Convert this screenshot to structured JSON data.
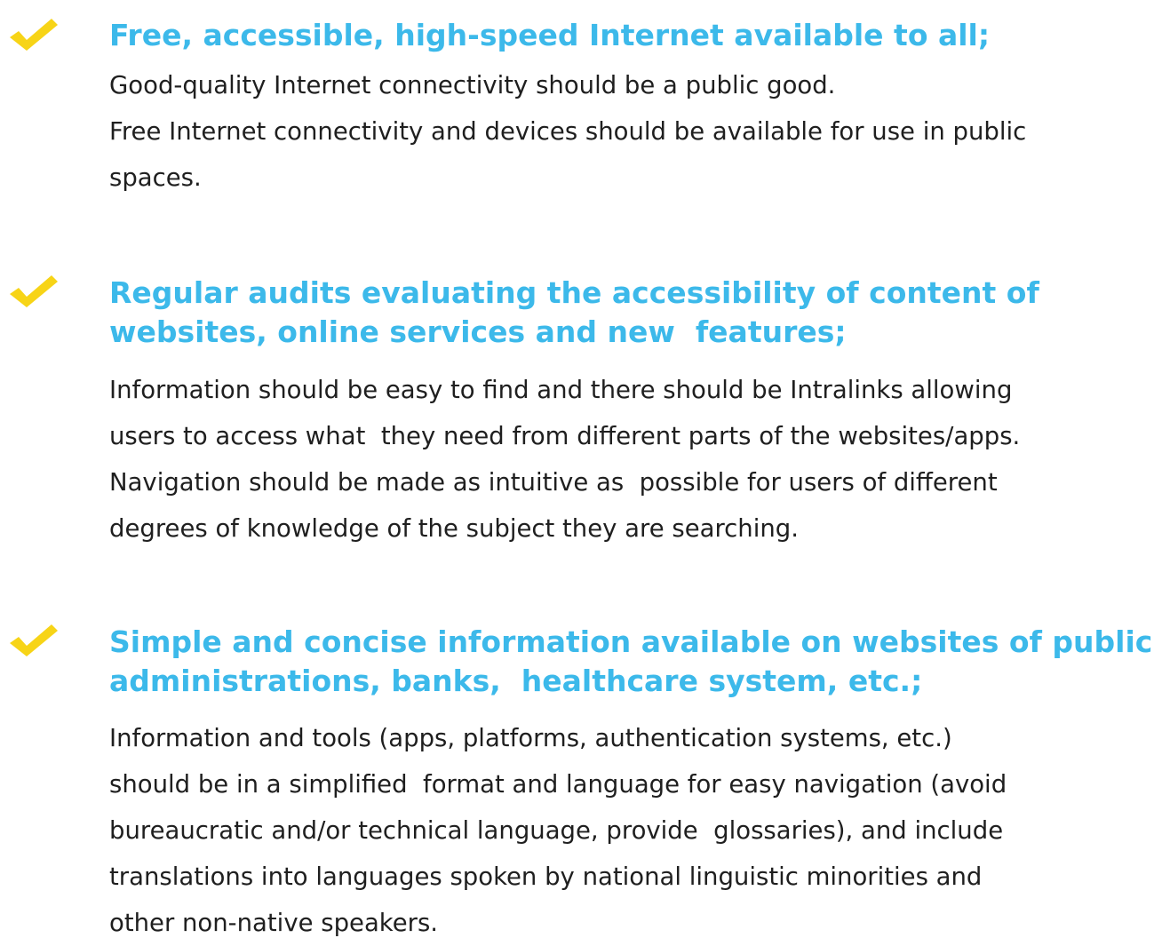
{
  "accent_color": "#3cb9ea",
  "check_color": "#f7d417",
  "text_color": "#1f1f1f",
  "icon": "checkmark-icon",
  "items": [
    {
      "heading_lines": [
        "Free, accessible, high-speed Internet available to all;"
      ],
      "body_lines": [
        "Good-quality Internet connectivity should be a public good.",
        "Free Internet connectivity and devices should be available for use in public",
        "spaces."
      ]
    },
    {
      "heading_lines": [
        "Regular audits evaluating the accessibility of content of",
        "websites, online services and new  features;"
      ],
      "body_lines": [
        "Information should be easy to find and there should be Intralinks allowing",
        "users to access what  they need from different parts of the websites/apps.",
        "Navigation should be made as intuitive as  possible for users of different",
        "degrees of knowledge of the subject they are searching."
      ]
    },
    {
      "heading_lines": [
        "Simple and concise information available on websites of public",
        "administrations, banks,  healthcare system, etc.;"
      ],
      "body_lines": [
        "Information and tools (apps, platforms, authentication systems, etc.)",
        "should be in a simplified  format and language for easy navigation (avoid",
        "bureaucratic and/or technical language, provide  glossaries), and include",
        "translations into languages spoken by national linguistic minorities and",
        "other non-native speakers."
      ]
    }
  ]
}
